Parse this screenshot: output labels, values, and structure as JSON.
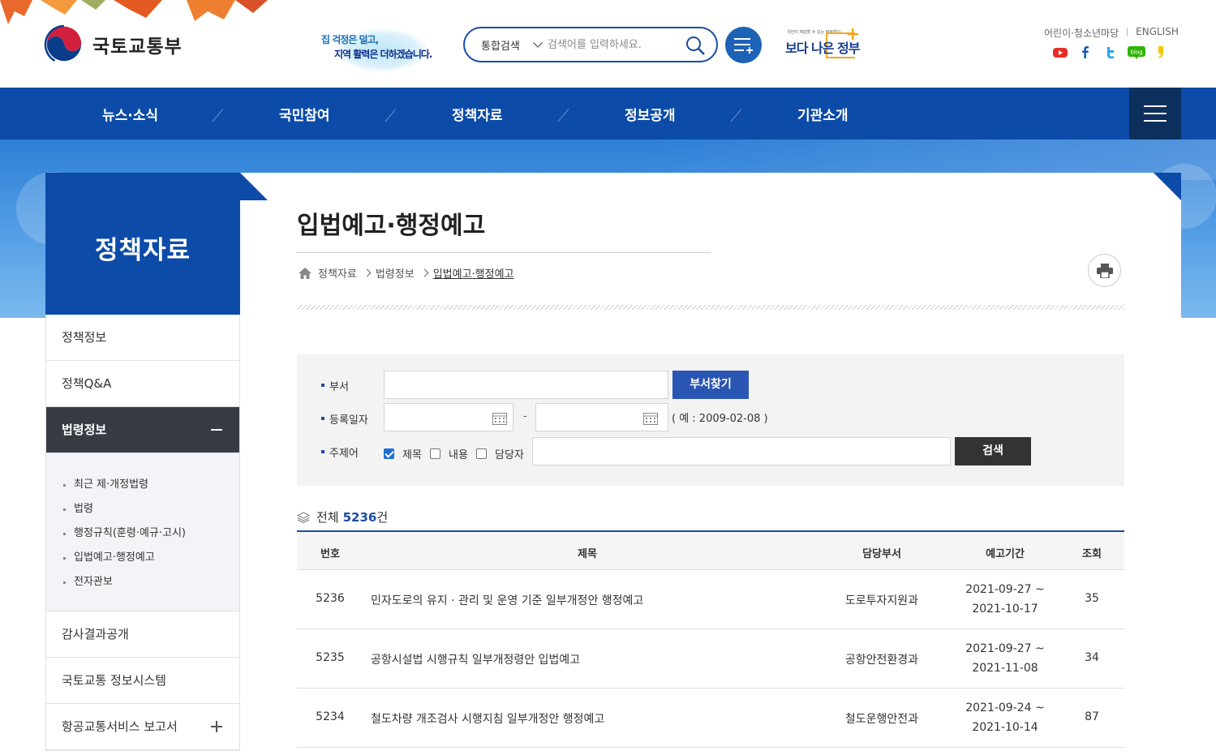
{
  "header": {
    "site_name": "국토교통부",
    "slogan_line1": "집 걱정은 덜고,",
    "slogan_line2": "지역 활력은 더하겠습니다.",
    "search_scope": "통합검색",
    "search_placeholder": "검색어를 입력하세요.",
    "better_gov_small": "국민이 체감할 수 있는 정부혁신",
    "better_gov_title": "보다 나은 정부",
    "util_links": [
      "어린이·청소년마당",
      "ENGLISH"
    ],
    "sns": [
      "youtube-icon",
      "facebook-icon",
      "twitter-icon",
      "blog-icon",
      "kakao-icon"
    ]
  },
  "gnb": {
    "items": [
      "뉴스·소식",
      "국민참여",
      "정책자료",
      "정보공개",
      "기관소개"
    ]
  },
  "lnb": {
    "title": "정책자료",
    "items": [
      "정책정보",
      "정책Q&A",
      "법령정보",
      "감사결과공개",
      "국토교통 정보시스템",
      "항공교통서비스 보고서"
    ],
    "sub_items": [
      "최근 제·개정법령",
      "법령",
      "행정규칙(훈령·예규·고시)",
      "입법예고·행정예고",
      "전자관보"
    ]
  },
  "page": {
    "title": "입법예고·행정예고",
    "breadcrumb": [
      "정책자료",
      "법령정보",
      "입법예고·행정예고"
    ]
  },
  "search": {
    "dept_label": "부서",
    "dept_button": "부서찾기",
    "date_label": "등록일자",
    "date_separator": "-",
    "date_example": "( 예 : 2009-02-08 )",
    "keyword_label": "주제어",
    "checkbox_title": "제목",
    "checkbox_content": "내용",
    "checkbox_manager": "담당자",
    "search_button": "검색"
  },
  "list": {
    "total_prefix": "전체",
    "total_count": "5236",
    "total_suffix": "건",
    "columns": [
      "번호",
      "제목",
      "담당부서",
      "예고기간",
      "조회"
    ],
    "rows": [
      {
        "num": "5236",
        "title": "민자도로의 유지 · 관리 및 운영 기준 일부개정안 행정예고",
        "dept": "도로투자지원과",
        "period_start": "2021-09-27 ~",
        "period_end": "2021-10-17",
        "views": "35"
      },
      {
        "num": "5235",
        "title": "공항시설법 시행규칙 일부개정령안 입법예고",
        "dept": "공항안전환경과",
        "period_start": "2021-09-27 ~",
        "period_end": "2021-11-08",
        "views": "34"
      },
      {
        "num": "5234",
        "title": "철도차량 개조검사 시행지침 일부개정안 행정예고",
        "dept": "철도운행안전과",
        "period_start": "2021-09-24 ~",
        "period_end": "2021-10-14",
        "views": "87"
      }
    ]
  },
  "colors": {
    "primary": "#0c4ba8",
    "dark": "#373b44",
    "accent_button": "#2a56b3"
  }
}
